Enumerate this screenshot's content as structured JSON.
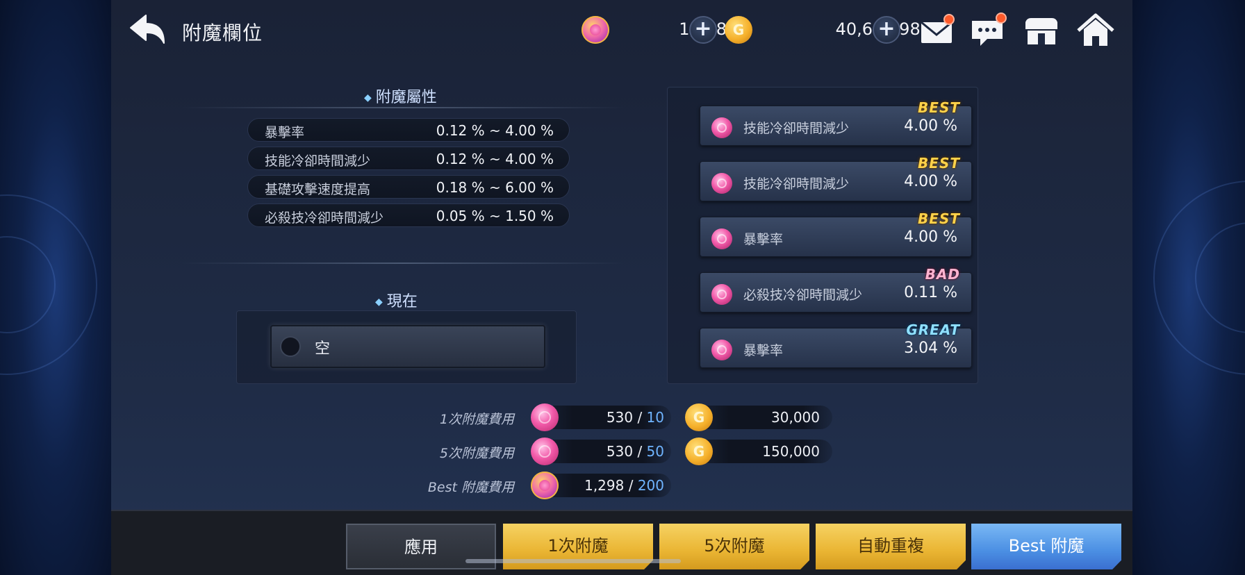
{
  "header": {
    "title": "附魔欄位",
    "rainbow_gem_count": "1,298",
    "gold_count": "40,611,982",
    "gold_icon_letter": "G"
  },
  "properties": {
    "heading": "附魔屬性",
    "rows": [
      {
        "name": "暴擊率",
        "range": "0.12 % ~ 4.00 %"
      },
      {
        "name": "技能冷卻時間減少",
        "range": "0.12 % ~ 4.00 %"
      },
      {
        "name": "基礎攻擊速度提高",
        "range": "0.18 % ~ 6.00 %"
      },
      {
        "name": "必殺技冷卻時間減少",
        "range": "0.05 % ~ 1.50 %"
      }
    ]
  },
  "current": {
    "heading": "現在",
    "slot_label": "空"
  },
  "options": [
    {
      "grade": "BEST",
      "name": "技能冷卻時間減少",
      "value": "4.00 %"
    },
    {
      "grade": "BEST",
      "name": "技能冷卻時間減少",
      "value": "4.00 %"
    },
    {
      "grade": "BEST",
      "name": "暴擊率",
      "value": "4.00 %"
    },
    {
      "grade": "BAD",
      "name": "必殺技冷卻時間減少",
      "value": "0.11 %"
    },
    {
      "grade": "GREAT",
      "name": "暴擊率",
      "value": "3.04 %"
    }
  ],
  "costs": [
    {
      "label": "1次附魔費用",
      "gem_have": "530",
      "gem_need": "10",
      "gold": "30,000"
    },
    {
      "label": "5次附魔費用",
      "gem_have": "530",
      "gem_need": "50",
      "gold": "150,000"
    },
    {
      "label": "Best 附魔費用",
      "gem_have": "1,298",
      "gem_need": "200"
    }
  ],
  "buttons": {
    "apply": "應用",
    "enchant_1": "1次附魔",
    "enchant_5": "5次附魔",
    "auto_repeat": "自動重複",
    "best_enchant": "Best 附魔"
  },
  "colors": {
    "best": "#ffd24a",
    "bad": "#ffb3d0",
    "great": "#8fe0ff",
    "gold_button": "#eab533",
    "blue_button": "#4b8fe3",
    "notification": "#ff5a2a"
  },
  "icons": [
    "back-arrow-icon",
    "rainbow-gem-icon",
    "gold-coin-icon",
    "plus-icon",
    "mail-icon",
    "chat-icon",
    "shop-icon",
    "home-icon",
    "pink-gem-icon"
  ]
}
